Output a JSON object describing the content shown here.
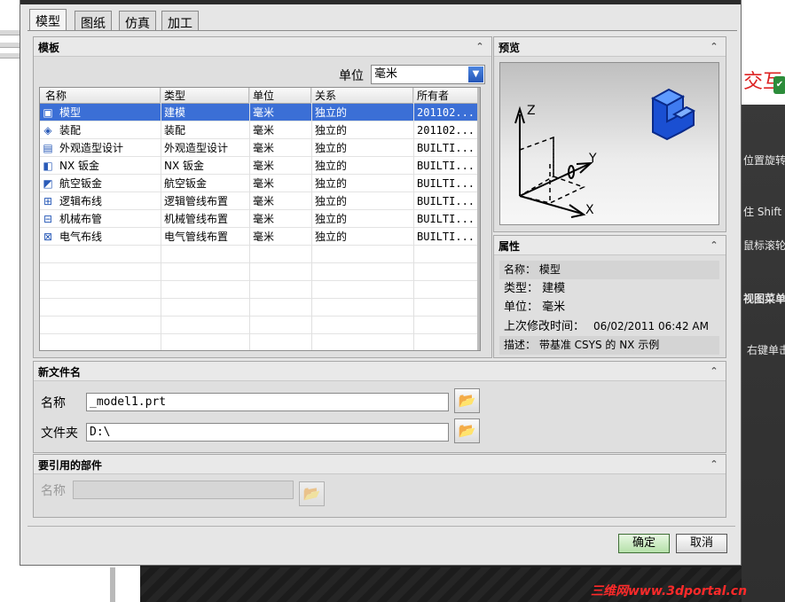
{
  "tabs": [
    "模型",
    "图纸",
    "仿真",
    "加工"
  ],
  "active_tab": 0,
  "templates": {
    "title": "模板",
    "unit_label": "单位",
    "unit_value": "毫米",
    "columns": [
      "名称",
      "类型",
      "单位",
      "关系",
      "所有者"
    ],
    "rows": [
      {
        "icon": "model-icon",
        "name": "模型",
        "type": "建模",
        "unit": "毫米",
        "rel": "独立的",
        "owner": "201102...",
        "selected": true
      },
      {
        "icon": "assembly-icon",
        "name": "装配",
        "type": "装配",
        "unit": "毫米",
        "rel": "独立的",
        "owner": "201102...",
        "selected": false
      },
      {
        "icon": "shape-studio-icon",
        "name": "外观造型设计",
        "type": "外观造型设计",
        "unit": "毫米",
        "rel": "独立的",
        "owner": "BUILTI...",
        "selected": false
      },
      {
        "icon": "sheet-metal-icon",
        "name": "NX 钣金",
        "type": "NX 钣金",
        "unit": "毫米",
        "rel": "独立的",
        "owner": "BUILTI...",
        "selected": false
      },
      {
        "icon": "aero-sheet-metal-icon",
        "name": "航空钣金",
        "type": "航空钣金",
        "unit": "毫米",
        "rel": "独立的",
        "owner": "BUILTI...",
        "selected": false
      },
      {
        "icon": "logical-routing-icon",
        "name": "逻辑布线",
        "type": "逻辑管线布置",
        "unit": "毫米",
        "rel": "独立的",
        "owner": "BUILTI...",
        "selected": false
      },
      {
        "icon": "mech-routing-icon",
        "name": "机械布管",
        "type": "机械管线布置",
        "unit": "毫米",
        "rel": "独立的",
        "owner": "BUILTI...",
        "selected": false
      },
      {
        "icon": "elec-routing-icon",
        "name": "电气布线",
        "type": "电气管线布置",
        "unit": "毫米",
        "rel": "独立的",
        "owner": "BUILTI...",
        "selected": false
      }
    ]
  },
  "preview": {
    "title": "预览",
    "axes": [
      "Z",
      "Y",
      "X"
    ]
  },
  "properties": {
    "title": "属性",
    "name": "名称： 模型",
    "type": "类型： 建模",
    "unit": "单位： 毫米",
    "modified_label": "上次修改时间：",
    "modified_value": "06/02/2011 06:42 AM",
    "desc": "描述： 带基准 CSYS 的 NX 示例"
  },
  "new_file": {
    "title": "新文件名",
    "name_label": "名称",
    "name_value": "_model1.prt",
    "folder_label": "文件夹",
    "folder_value": "D:\\"
  },
  "ref_part": {
    "title": "要引用的部件",
    "name_label": "名称",
    "name_value": ""
  },
  "buttons": {
    "ok": "确定",
    "cancel": "取消"
  },
  "background": {
    "right_texts": [
      "交互",
      "位置旋转,",
      "住 Shift",
      "鼠标滚轮",
      "视图菜单",
      "右键单击"
    ],
    "watermark": "三维网www.3dportal.cn"
  },
  "colors": {
    "selection": "#3b6fd6",
    "watermark": "#ff2a2a",
    "ok_button": "#b5e0a9"
  }
}
